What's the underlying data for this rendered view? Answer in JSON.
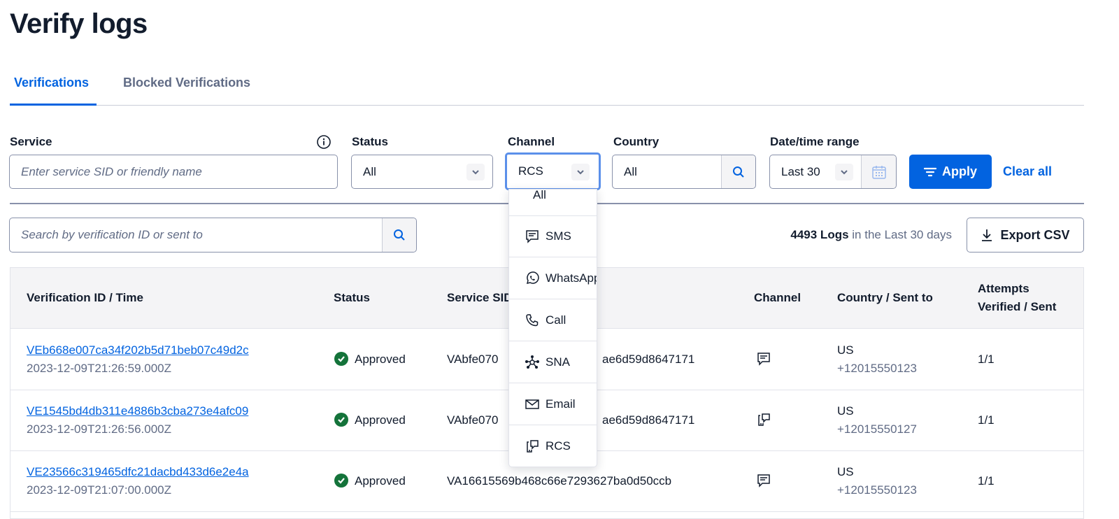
{
  "page": {
    "title": "Verify logs"
  },
  "tabs": [
    {
      "label": "Verifications",
      "active": true
    },
    {
      "label": "Blocked Verifications",
      "active": false
    }
  ],
  "filters": {
    "service": {
      "label": "Service",
      "placeholder": "Enter service SID or friendly name",
      "icon": "info-icon"
    },
    "status": {
      "label": "Status",
      "value": "All"
    },
    "channel": {
      "label": "Channel",
      "value": "RCS",
      "open": true,
      "options": [
        {
          "label": "All",
          "icon": ""
        },
        {
          "label": "SMS",
          "icon": "sms-icon"
        },
        {
          "label": "WhatsApp",
          "icon": "whatsapp-icon"
        },
        {
          "label": "Call",
          "icon": "phone-icon"
        },
        {
          "label": "SNA",
          "icon": "sna-icon"
        },
        {
          "label": "Email",
          "icon": "email-icon"
        },
        {
          "label": "RCS",
          "icon": "rcs-icon"
        }
      ]
    },
    "country": {
      "label": "Country",
      "value": "All"
    },
    "daterange": {
      "label": "Date/time range",
      "value": "Last 30"
    },
    "apply_label": "Apply",
    "clear_label": "Clear all"
  },
  "search": {
    "placeholder": "Search by verification ID or sent to"
  },
  "summary": {
    "count": "4493 Logs",
    "suffix": "in the Last 30 days"
  },
  "export_label": "Export CSV",
  "table": {
    "headers": [
      "Verification ID / Time",
      "Status",
      "Service SID",
      "Channel",
      "Country / Sent to",
      "Attempts",
      "Verified / Sent"
    ],
    "rows": [
      {
        "id": "VEb668e007ca34f202b5d71beb07c49d2c",
        "time": "2023-12-09T21:26:59.000Z",
        "status": "Approved",
        "sid_start": "VAbfe070",
        "sid_end": "ae6d59d8647171",
        "channel": "sms-icon",
        "country": "US",
        "to": "+12015550123",
        "attempts": "1/1"
      },
      {
        "id": "VE1545bd4db311e4886b3cba273e4afc09",
        "time": "2023-12-09T21:26:56.000Z",
        "status": "Approved",
        "sid_start": "VAbfe070",
        "sid_end": "ae6d59d8647171",
        "channel": "rcs-icon",
        "country": "US",
        "to": "+12015550127",
        "attempts": "1/1"
      },
      {
        "id": "VE23566c319465dfc21dacbd433d6e2e4a",
        "time": "2023-12-09T21:07:00.000Z",
        "status": "Approved",
        "sid_start": "VA16615569b468c66e7293627ba0d50ccb",
        "sid_end": "",
        "channel": "sms-icon",
        "country": "US",
        "to": "+12015550123",
        "attempts": "1/1"
      }
    ]
  },
  "colors": {
    "accent": "#0263e0",
    "approved": "#14733a",
    "text": "#121c2d",
    "muted": "#606b85"
  }
}
